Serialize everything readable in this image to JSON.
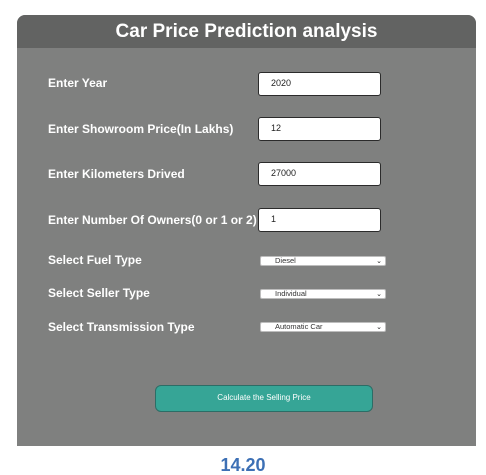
{
  "header": {
    "title": "Car Price Prediction analysis"
  },
  "form": {
    "year": {
      "label": "Enter Year",
      "value": "2020"
    },
    "showroom_price": {
      "label": "Enter Showroom Price(In Lakhs)",
      "value": "12"
    },
    "kms_driven": {
      "label": "Enter Kilometers Drived",
      "value": "27000"
    },
    "owners": {
      "label": "Enter Number Of Owners(0 or 1 or 2)",
      "value": "1"
    },
    "fuel_type": {
      "label": "Select Fuel Type",
      "selected": "Diesel"
    },
    "seller_type": {
      "label": "Select Seller Type",
      "selected": "Individual"
    },
    "transmission": {
      "label": "Select Transmission Type",
      "selected": "Automatic Car"
    },
    "submit_label": "Calculate the Selling Price"
  },
  "result": {
    "value": "14.20"
  },
  "icons": {
    "dropdown": "chevron-down-icon"
  },
  "colors": {
    "header_bg": "#626362",
    "panel_bg": "#7f807f",
    "button_bg": "#36a596",
    "result_text": "#3d70b5"
  }
}
